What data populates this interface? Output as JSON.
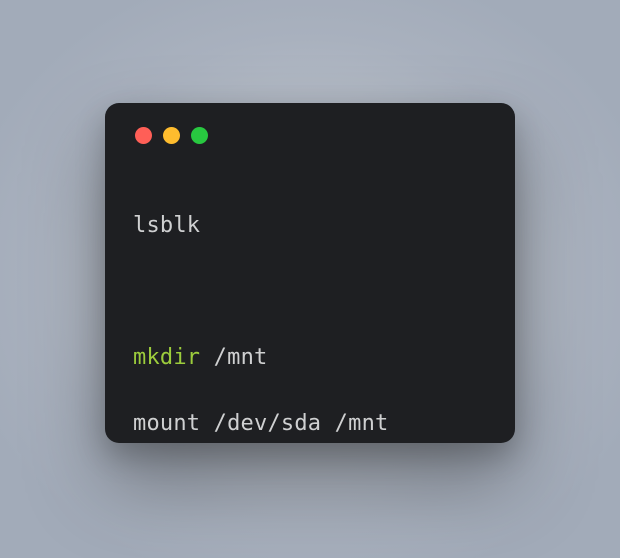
{
  "window": {
    "type": "macos-terminal",
    "traffic_lights": [
      "close",
      "minimize",
      "zoom"
    ]
  },
  "code": {
    "line1": {
      "cmd": "lsblk"
    },
    "line3": {
      "cmd": "mkdir",
      "arg": " /mnt"
    },
    "line4": {
      "cmd": "mount /dev/sda /mnt"
    }
  },
  "colors": {
    "window_bg": "#1e1f22",
    "text": "#cfd0d1",
    "keyword": "#9ccc3c",
    "red": "#ff5f57",
    "yellow": "#febc2e",
    "green": "#28c840"
  }
}
